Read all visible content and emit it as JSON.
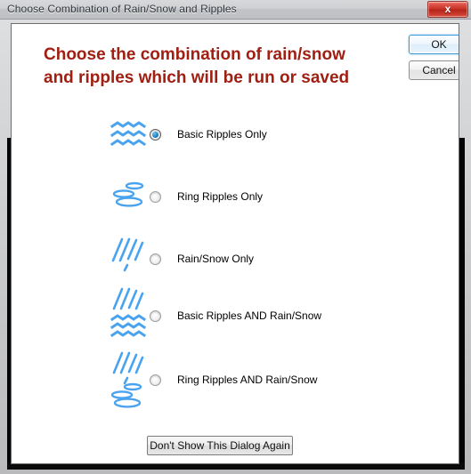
{
  "window": {
    "title": "Choose Combination of Rain/Snow and Ripples",
    "close_label": "x"
  },
  "heading": {
    "line1": "Choose the combination of rain/snow",
    "line2": "and ripples which will be run or saved",
    "color": "#a01f12"
  },
  "buttons": {
    "ok": "OK",
    "cancel": "Cancel",
    "dont_show": "Don't Show This Dialog Again"
  },
  "colors": {
    "ripple_blue": "#4aa3ef",
    "ripple_light": "#8ec9f7",
    "accent_focus": "#3c9ada"
  },
  "options": [
    {
      "label": "Basic Ripples Only",
      "icon": "waves-icon",
      "selected": true
    },
    {
      "label": "Ring Ripples Only",
      "icon": "rings-icon",
      "selected": false
    },
    {
      "label": "Rain/Snow Only",
      "icon": "rain-icon",
      "selected": false
    },
    {
      "label": "Basic Ripples  AND  Rain/Snow",
      "icon": "rain-and-waves-icon",
      "selected": false
    },
    {
      "label": "Ring Ripples  AND  Rain/Snow",
      "icon": "rain-and-rings-icon",
      "selected": false
    }
  ]
}
